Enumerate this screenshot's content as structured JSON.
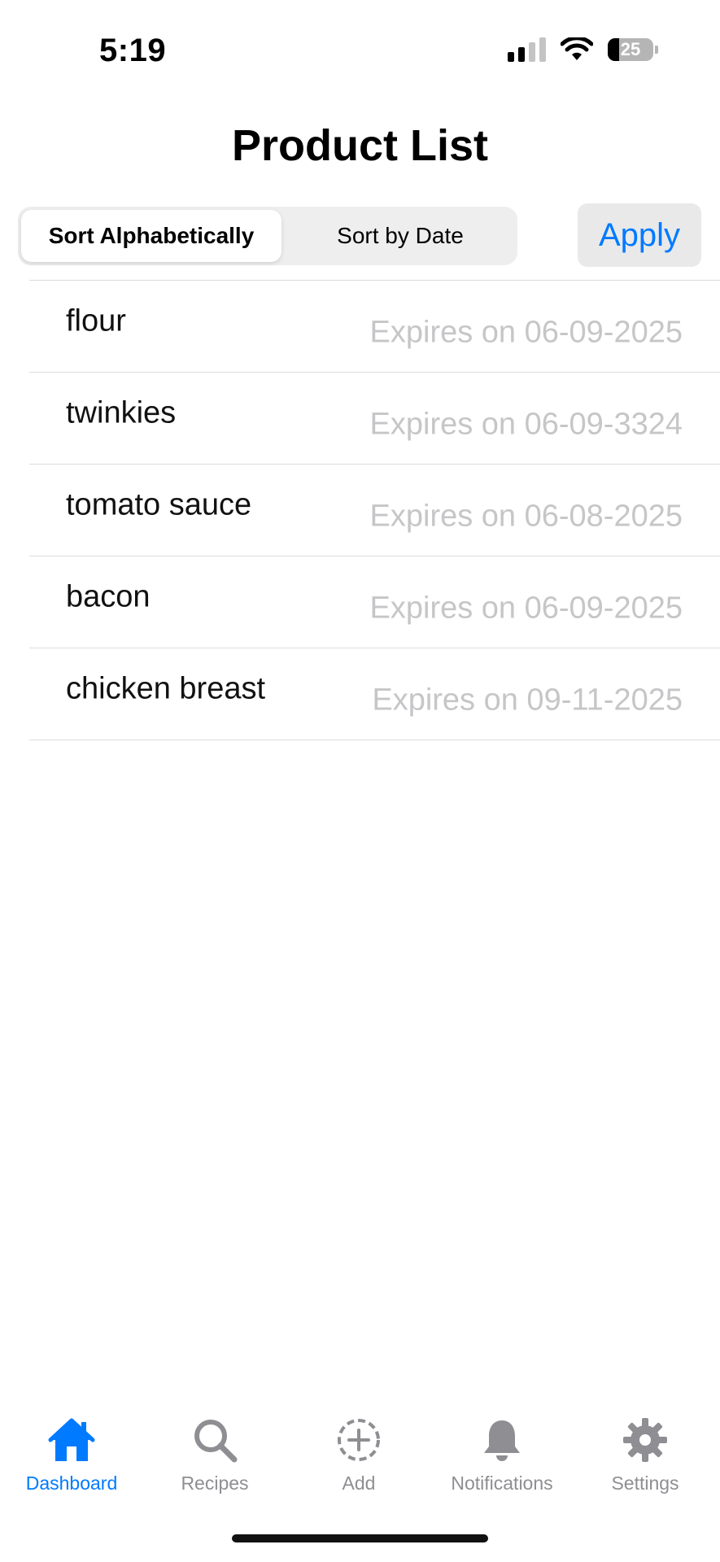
{
  "status_bar": {
    "time": "5:19",
    "battery_level": "25",
    "icons": [
      "cellular-signal-icon",
      "wifi-icon",
      "battery-icon"
    ]
  },
  "header": {
    "title": "Product List"
  },
  "sort_control": {
    "options": [
      "Sort Alphabetically",
      "Sort by Date"
    ],
    "selected": "Sort Alphabetically"
  },
  "apply_label": "Apply",
  "products": [
    {
      "name": "flour",
      "expiry": "Expires on 06-09-2025"
    },
    {
      "name": "twinkies",
      "expiry": "Expires on 06-09-3324"
    },
    {
      "name": "tomato sauce",
      "expiry": "Expires on 06-08-2025"
    },
    {
      "name": "bacon",
      "expiry": "Expires on 06-09-2025"
    },
    {
      "name": "chicken breast",
      "expiry": "Expires on 09-11-2025"
    }
  ],
  "tab_bar": {
    "active": "Dashboard",
    "tabs": [
      {
        "label": "Dashboard",
        "icon": "house-icon"
      },
      {
        "label": "Recipes",
        "icon": "magnifying-glass-icon"
      },
      {
        "label": "Add",
        "icon": "plus-circle-dashed-icon"
      },
      {
        "label": "Notifications",
        "icon": "bell-icon"
      },
      {
        "label": "Settings",
        "icon": "gear-icon"
      }
    ]
  },
  "colors": {
    "accent": "#007aff",
    "inactive_tab": "#8e8e93",
    "secondary_text": "#c6c6c8",
    "segment_background": "#eeeeef"
  }
}
